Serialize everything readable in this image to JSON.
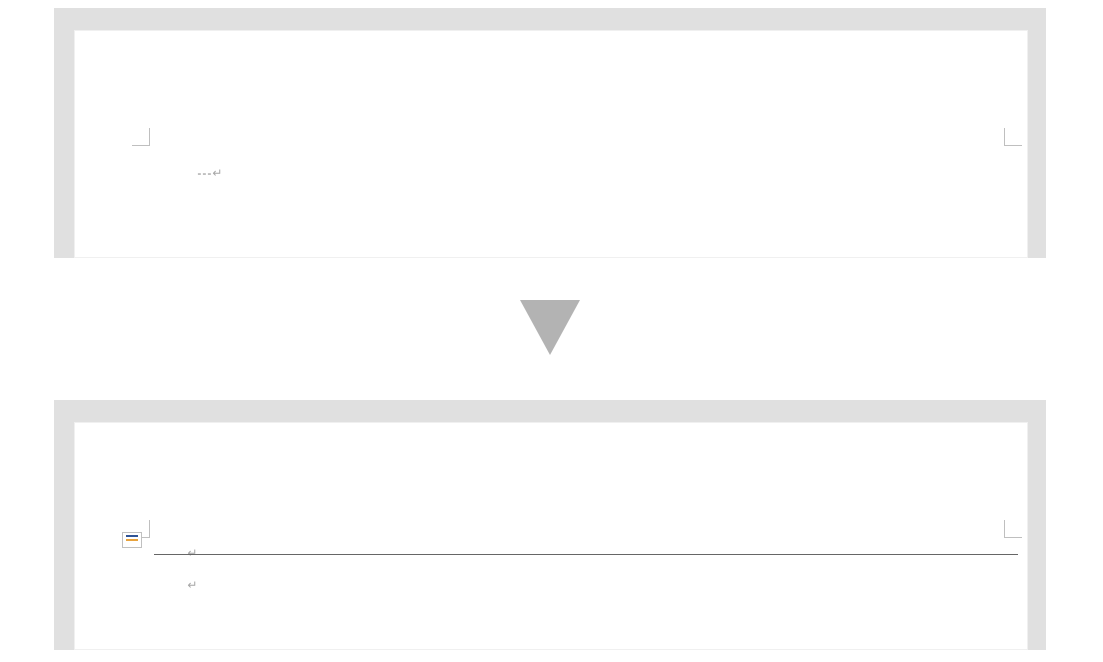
{
  "before": {
    "typed_text": "---",
    "paragraph_mark": "↵"
  },
  "after": {
    "paragraph_mark_above": "↵",
    "paragraph_mark_below": "↵"
  },
  "icons": {
    "transition_arrow": "down-triangle",
    "gutter_indicator": "autoformat-indicator"
  }
}
